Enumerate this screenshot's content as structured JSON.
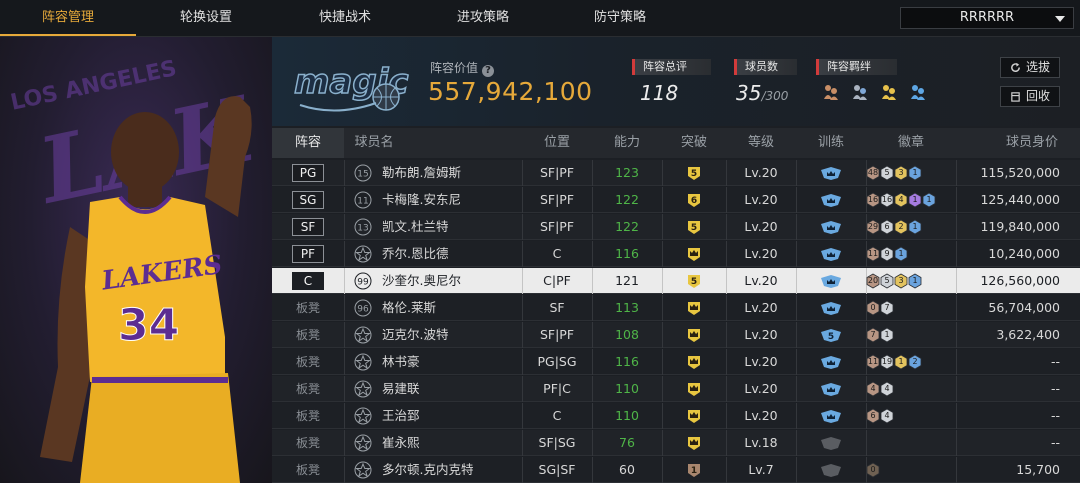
{
  "nav": {
    "tabs": [
      "阵容管理",
      "轮换设置",
      "快捷战术",
      "进攻策略",
      "防守策略"
    ],
    "active_index": 0
  },
  "team_select": {
    "value": "RRRRRR"
  },
  "header": {
    "value_label": "阵容价值",
    "value_number": "557,942,100",
    "rating_label": "阵容总评",
    "rating_value": "118",
    "players_label": "球员数",
    "players_value": "35",
    "players_max": "/300",
    "bonds_label": "阵容羁绊",
    "select_button": "选拔",
    "recycle_button": "回收"
  },
  "columns": [
    "阵容",
    "球员名",
    "位置",
    "能力",
    "突破",
    "等级",
    "训练",
    "徽章",
    "球员身价"
  ],
  "rows": [
    {
      "slot": "PG",
      "number": "15",
      "name": "勒布朗.詹姆斯",
      "position": "SF|PF",
      "ability": "123",
      "ability_color": "green",
      "breakthrough": "5",
      "break_color": "#e8c640",
      "level": "Lv.20",
      "train": "blue",
      "badges": [
        {
          "n": "48",
          "c": "#b79583"
        },
        {
          "n": "5",
          "c": "#cfd3d8"
        },
        {
          "n": "3",
          "c": "#e3c35e"
        },
        {
          "n": "1",
          "c": "#6aa3de"
        }
      ],
      "value": "115,520,000"
    },
    {
      "slot": "SG",
      "number": "11",
      "name": "卡梅隆.安东尼",
      "position": "SF|PF",
      "ability": "122",
      "ability_color": "green",
      "breakthrough": "6",
      "break_color": "#e8c640",
      "level": "Lv.20",
      "train": "blue",
      "badges": [
        {
          "n": "16",
          "c": "#b79583"
        },
        {
          "n": "16",
          "c": "#cfd3d8"
        },
        {
          "n": "4",
          "c": "#e3c35e"
        },
        {
          "n": "1",
          "c": "#a57be0"
        },
        {
          "n": "1",
          "c": "#6aa3de"
        }
      ],
      "value": "125,440,000"
    },
    {
      "slot": "SF",
      "number": "13",
      "name": "凯文.杜兰特",
      "position": "SF|PF",
      "ability": "122",
      "ability_color": "green",
      "breakthrough": "5",
      "break_color": "#e8c640",
      "level": "Lv.20",
      "train": "blue",
      "badges": [
        {
          "n": "29",
          "c": "#b79583"
        },
        {
          "n": "6",
          "c": "#cfd3d8"
        },
        {
          "n": "2",
          "c": "#e3c35e"
        },
        {
          "n": "1",
          "c": "#6aa3de"
        }
      ],
      "value": "119,840,000"
    },
    {
      "slot": "PF",
      "number": "",
      "name": "乔尔.恩比德",
      "position": "C",
      "ability": "116",
      "ability_color": "green",
      "breakthrough": "",
      "break_color": "#e8c640",
      "level": "Lv.20",
      "train": "blue",
      "badges": [
        {
          "n": "11",
          "c": "#b79583"
        },
        {
          "n": "9",
          "c": "#cfd3d8"
        },
        {
          "n": "1",
          "c": "#6aa3de"
        }
      ],
      "value": "10,240,000"
    },
    {
      "slot": "C",
      "number": "99",
      "name": "沙奎尔.奥尼尔",
      "position": "C|PF",
      "ability": "121",
      "ability_color": "white",
      "breakthrough": "5",
      "break_color": "#e8c640",
      "level": "Lv.20",
      "train": "blue",
      "badges": [
        {
          "n": "20",
          "c": "#b79583"
        },
        {
          "n": "5",
          "c": "#cfd3d8"
        },
        {
          "n": "3",
          "c": "#e3c35e"
        },
        {
          "n": "1",
          "c": "#6aa3de"
        }
      ],
      "value": "126,560,000",
      "selected": true
    },
    {
      "slot": "板凳",
      "number": "96",
      "name": "格伦.莱斯",
      "position": "SF",
      "ability": "113",
      "ability_color": "green",
      "breakthrough": "",
      "break_color": "#e8c640",
      "level": "Lv.20",
      "train": "blue",
      "badges": [
        {
          "n": "0",
          "c": "#b79583"
        },
        {
          "n": "7",
          "c": "#cfd3d8"
        }
      ],
      "value": "56,704,000"
    },
    {
      "slot": "板凳",
      "number": "",
      "name": "迈克尔.波特",
      "position": "SF|PF",
      "ability": "108",
      "ability_color": "green",
      "breakthrough": "",
      "break_color": "#e8c640",
      "level": "Lv.20",
      "train": "5",
      "badges": [
        {
          "n": "7",
          "c": "#b79583"
        },
        {
          "n": "1",
          "c": "#cfd3d8"
        }
      ],
      "value": "3,622,400"
    },
    {
      "slot": "板凳",
      "number": "",
      "name": "林书豪",
      "position": "PG|SG",
      "ability": "116",
      "ability_color": "green",
      "breakthrough": "",
      "break_color": "#e8c640",
      "level": "Lv.20",
      "train": "blue",
      "badges": [
        {
          "n": "11",
          "c": "#b79583"
        },
        {
          "n": "19",
          "c": "#cfd3d8"
        },
        {
          "n": "1",
          "c": "#e3c35e"
        },
        {
          "n": "2",
          "c": "#6aa3de"
        }
      ],
      "value": "--"
    },
    {
      "slot": "板凳",
      "number": "",
      "name": "易建联",
      "position": "PF|C",
      "ability": "110",
      "ability_color": "green",
      "breakthrough": "",
      "break_color": "#e8c640",
      "level": "Lv.20",
      "train": "blue",
      "badges": [
        {
          "n": "4",
          "c": "#b79583"
        },
        {
          "n": "4",
          "c": "#cfd3d8"
        }
      ],
      "value": "--"
    },
    {
      "slot": "板凳",
      "number": "",
      "name": "王治郅",
      "position": "C",
      "ability": "110",
      "ability_color": "green",
      "breakthrough": "",
      "break_color": "#e8c640",
      "level": "Lv.20",
      "train": "blue",
      "badges": [
        {
          "n": "6",
          "c": "#b79583"
        },
        {
          "n": "4",
          "c": "#cfd3d8"
        }
      ],
      "value": "--"
    },
    {
      "slot": "板凳",
      "number": "",
      "name": "崔永熙",
      "position": "SF|SG",
      "ability": "76",
      "ability_color": "green",
      "breakthrough": "",
      "break_color": "#e8c640",
      "level": "Lv.18",
      "train": "gray",
      "badges": [],
      "value": "--"
    },
    {
      "slot": "板凳",
      "number": "",
      "name": "多尔顿.克内克特",
      "position": "SG|SF",
      "ability": "60",
      "ability_color": "white",
      "breakthrough": "1",
      "break_color": "#a8866e",
      "level": "Lv.7",
      "train": "gray",
      "badges": [
        {
          "n": "0",
          "c": "#6f6152"
        }
      ],
      "value": "15,700"
    }
  ],
  "colors": {
    "accent": "#e6a93a",
    "ability_green": "#4fb548",
    "label_red": "#d23b3b"
  },
  "icons": {
    "help": "question-circle-icon",
    "select": "refresh-icon",
    "recycle": "trash-icon",
    "caret": "chevron-down-icon"
  }
}
